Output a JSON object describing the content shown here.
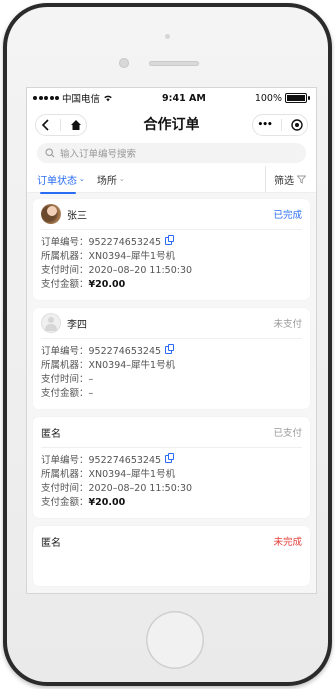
{
  "status_bar": {
    "carrier": "中国电信",
    "time": "9:41 AM",
    "battery": "100%"
  },
  "nav": {
    "title": "合作订单",
    "more_glyph": "•••"
  },
  "search": {
    "placeholder": "输入订单编号搜索"
  },
  "filters": {
    "order_status": "订单状态",
    "venue": "场所",
    "filter": "筛选"
  },
  "labels": {
    "order_no": "订单编号：",
    "machine": "所属机器：",
    "pay_time": "支付时间：",
    "pay_amount": "支付金额："
  },
  "orders": [
    {
      "name": "张三",
      "status": "已完成",
      "order_no": "952274653245",
      "machine": "XN0394–犀牛1号机",
      "pay_time": "2020–08–20 11:50:30",
      "pay_amount": "¥20.00"
    },
    {
      "name": "李四",
      "status": "未支付",
      "order_no": "952274653245",
      "machine": "XN0394–犀牛1号机",
      "pay_time": "–",
      "pay_amount": "–"
    },
    {
      "name": "匿名",
      "status": "已支付",
      "order_no": "952274653245",
      "machine": "XN0394–犀牛1号机",
      "pay_time": "2020–08–20 11:50:30",
      "pay_amount": "¥20.00"
    },
    {
      "name": "匿名",
      "status": "未完成"
    }
  ],
  "colors": {
    "accent": "#2a6df4",
    "danger": "#e53935",
    "muted": "#9a9a9a"
  }
}
